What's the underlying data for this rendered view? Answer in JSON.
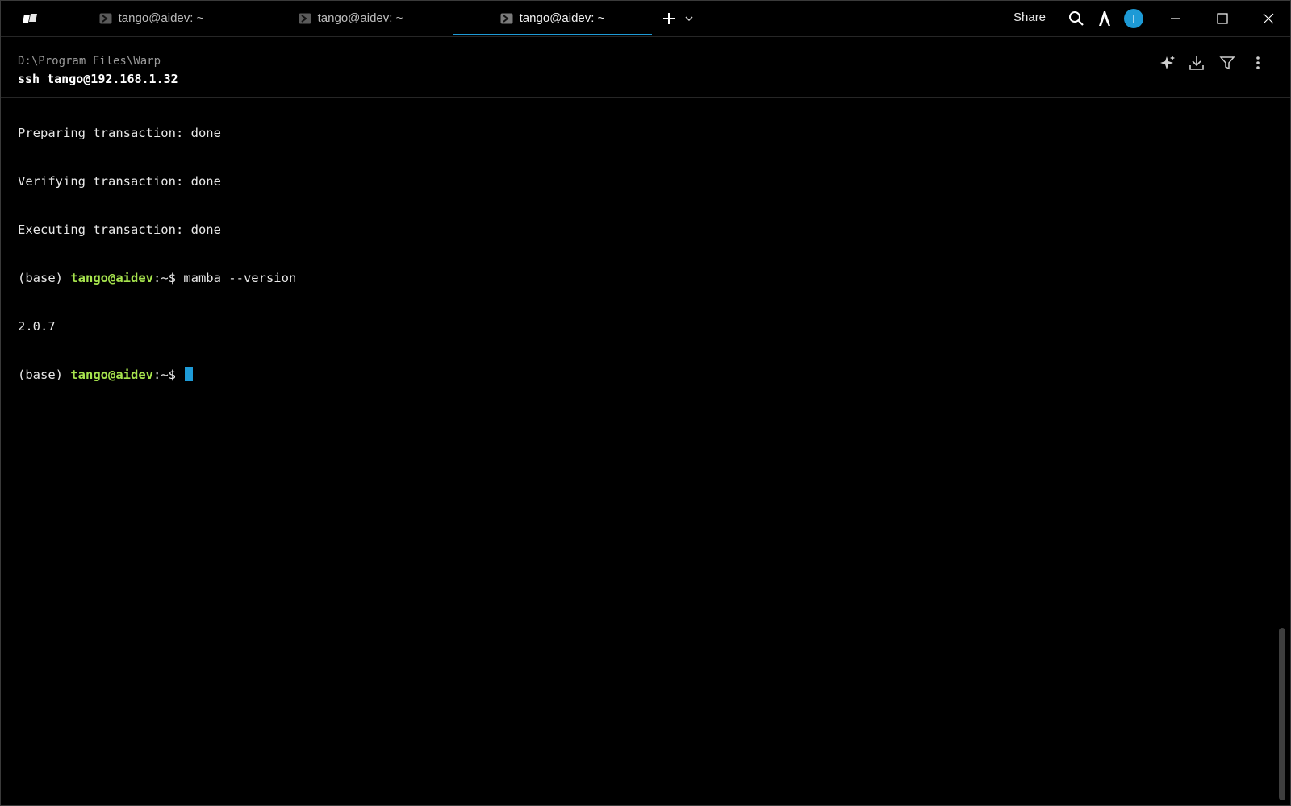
{
  "tabs": [
    {
      "label": "tango@aidev: ~",
      "active": false
    },
    {
      "label": "tango@aidev: ~",
      "active": false
    },
    {
      "label": "tango@aidev: ~",
      "active": true
    }
  ],
  "titlebar": {
    "share_label": "Share",
    "avatar_initial": "I"
  },
  "block": {
    "cwd": "D:\\Program Files\\Warp",
    "command": "ssh tango@192.168.1.32"
  },
  "output": {
    "lines": [
      "Preparing transaction: done",
      "Verifying transaction: done",
      "Executing transaction: done"
    ],
    "prompt1": {
      "env": "(base) ",
      "user": "tango@aidev",
      "path": ":~$ ",
      "command": "mamba --version"
    },
    "result": "2.0.7",
    "prompt2": {
      "env": "(base) ",
      "user": "tango@aidev",
      "path": ":~$ "
    }
  },
  "colors": {
    "accent": "#1e9bd7",
    "prompt_user": "#a6e34d",
    "background": "#000000"
  }
}
